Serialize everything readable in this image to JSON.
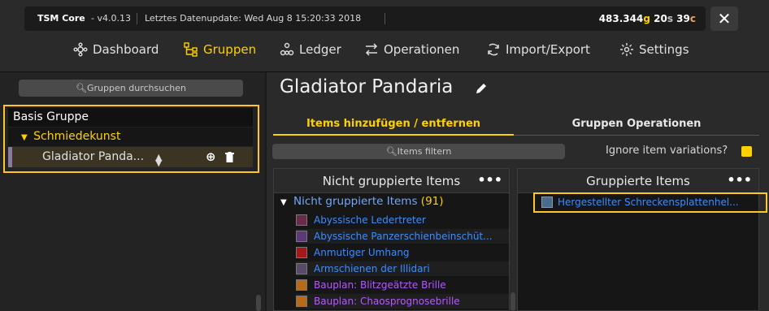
{
  "topbar": {
    "app_name": "TSM Core",
    "version": "- v4.0.13",
    "data_update": "Letztes Datenupdate:  Wed Aug  8 15:20:33 2018",
    "gold": "483.344",
    "gold_unit": "g",
    "silver": "20",
    "silver_unit": "s",
    "copper": "39",
    "copper_unit": "c"
  },
  "nav": {
    "dashboard": "Dashboard",
    "gruppen": "Gruppen",
    "ledger": "Ledger",
    "operationen": "Operationen",
    "import_export": "Import/Export",
    "settings": "Settings"
  },
  "left": {
    "search_placeholder": "Gruppen durchsuchen",
    "tree": [
      {
        "label": "Basis Gruppe"
      },
      {
        "label": "Schmiedekunst"
      },
      {
        "label": "Gladiator Panda..."
      }
    ]
  },
  "main": {
    "title": "Gladiator Pandaria",
    "tabs": [
      "Items hinzufügen / entfernen",
      "Gruppen Operationen"
    ],
    "item_search_placeholder": "Items filtern",
    "ignore_variations": "Ignore item variations?",
    "ungrouped": {
      "header": "Nicht gruppierte Items",
      "group_label": "Nicht gruppierte Items",
      "group_count": "(91)",
      "items": [
        {
          "name": "Abyssische Ledertreter",
          "quality": "blue"
        },
        {
          "name": "Abyssische Panzerschienbeinschüt...",
          "quality": "blue"
        },
        {
          "name": "Anmutiger Umhang",
          "quality": "blue"
        },
        {
          "name": "Armschienen der Illidari",
          "quality": "blue"
        },
        {
          "name": "Bauplan: Blitzgeätzte Brille",
          "quality": "purple"
        },
        {
          "name": "Bauplan: Chaosprognosebrille",
          "quality": "purple"
        }
      ]
    },
    "grouped": {
      "header": "Gruppierte Items",
      "items": [
        {
          "name": "Hergestellter Schreckensplattenhel...",
          "quality": "blue"
        }
      ]
    }
  },
  "colors": {
    "accent": "#ffd000",
    "highlight_border": "#ffc62a",
    "rare_blue": "#3d8cff",
    "epic_purple": "#b35aff"
  }
}
